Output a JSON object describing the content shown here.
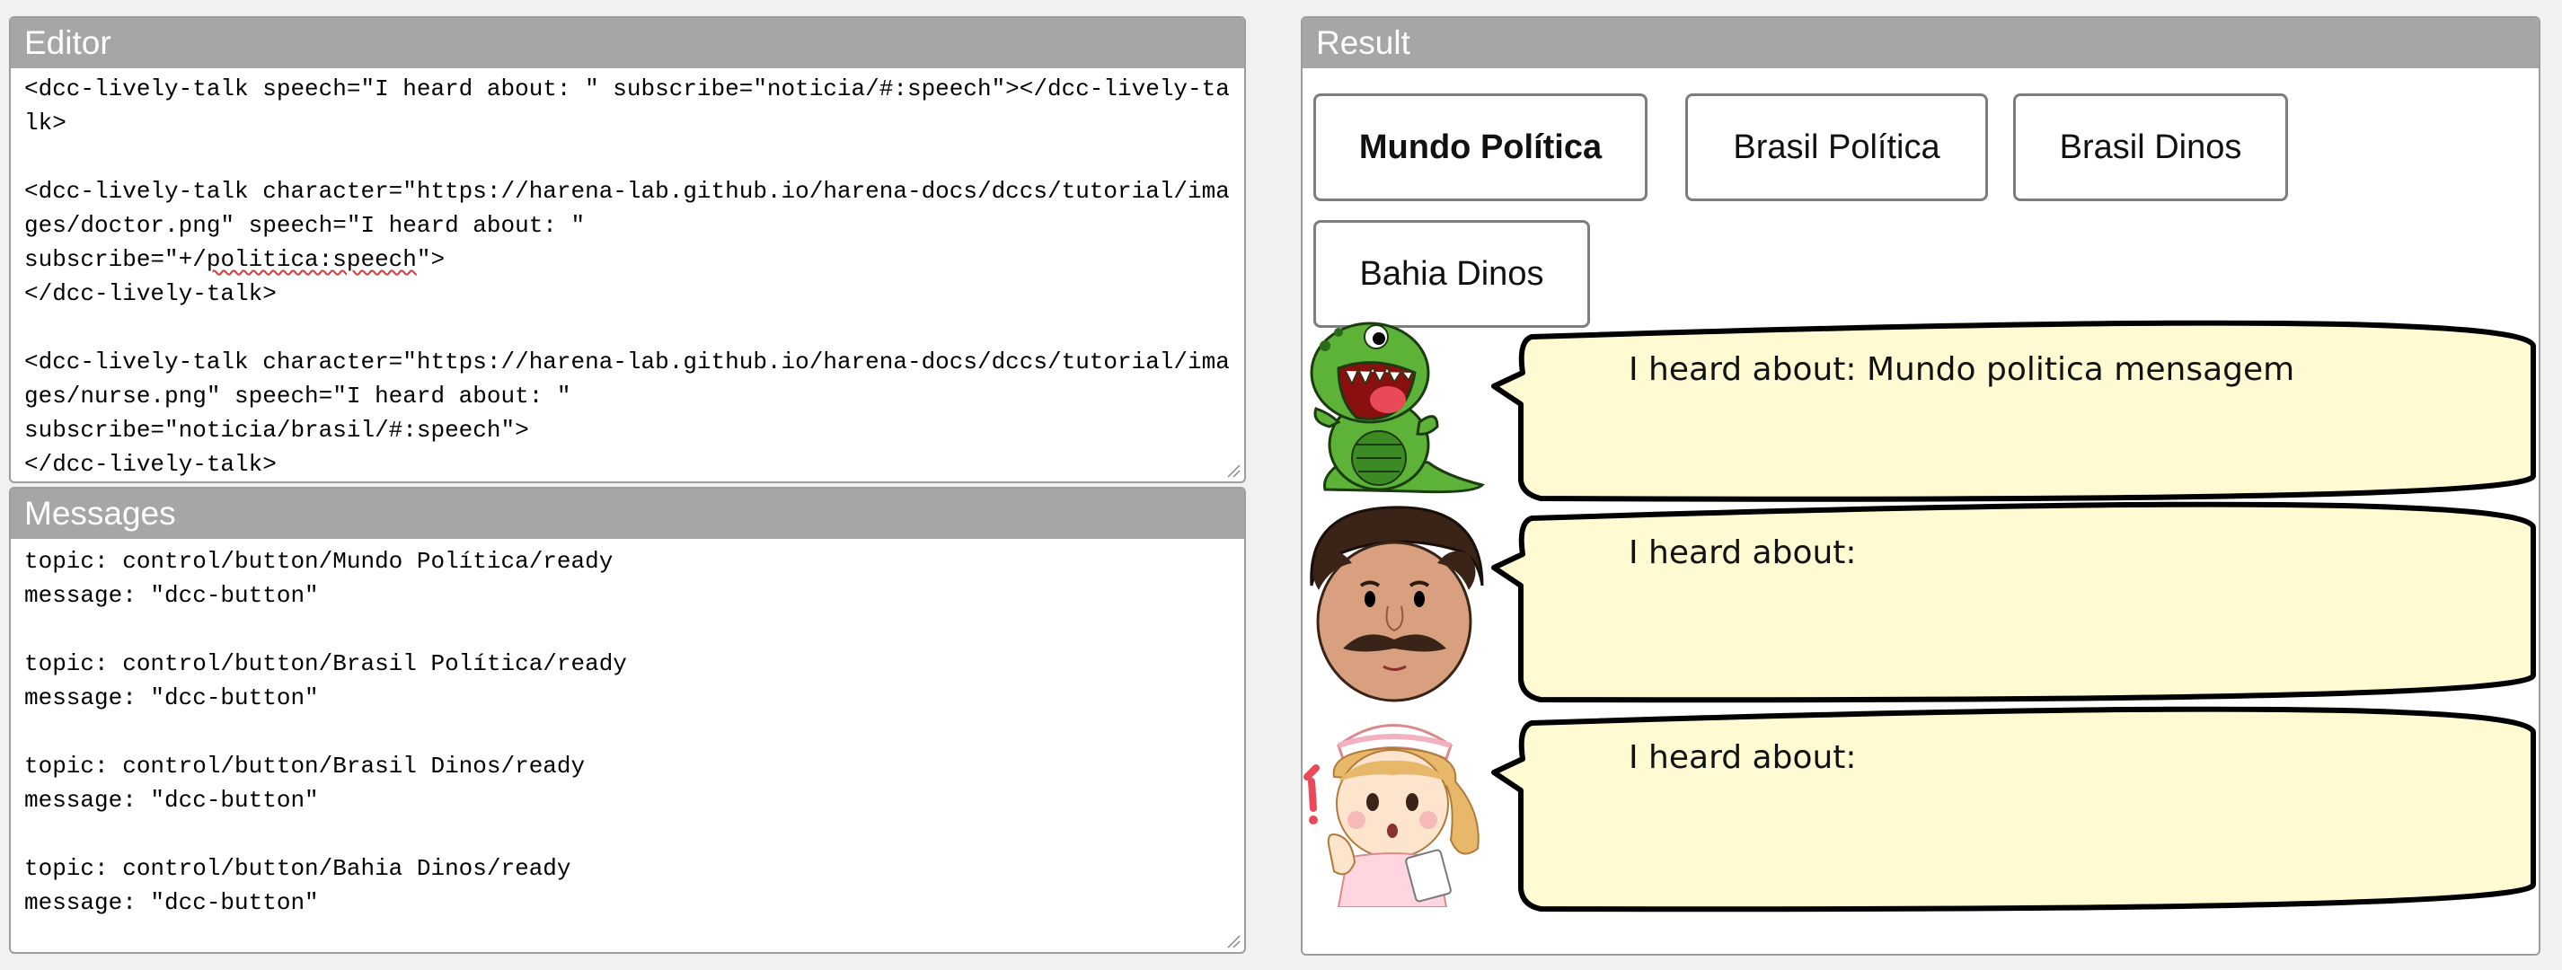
{
  "editor": {
    "title": "Editor",
    "code_before_spell": "<dcc-lively-talk speech=\"I heard about: \" subscribe=\"noticia/#:speech\"></dcc-lively-talk>\n\n<dcc-lively-talk character=\"https://harena-lab.github.io/harena-docs/dccs/tutorial/images/doctor.png\" speech=\"I heard about: \"\nsubscribe=\"+/",
    "code_spell": "politica:speech",
    "code_after_spell": "\">\n</dcc-lively-talk>\n\n<dcc-lively-talk character=\"https://harena-lab.github.io/harena-docs/dccs/tutorial/images/nurse.png\" speech=\"I heard about: \"\nsubscribe=\"noticia/brasil/#:speech\">\n</dcc-lively-talk>"
  },
  "messages": {
    "title": "Messages",
    "log": "topic: control/button/Mundo Política/ready\nmessage: \"dcc-button\"\n\ntopic: control/button/Brasil Política/ready\nmessage: \"dcc-button\"\n\ntopic: control/button/Brasil Dinos/ready\nmessage: \"dcc-button\"\n\ntopic: control/button/Bahia Dinos/ready\nmessage: \"dcc-button\""
  },
  "result": {
    "title": "Result",
    "buttons": [
      {
        "label": "Mundo Política"
      },
      {
        "label": "Brasil Política"
      },
      {
        "label": "Brasil Dinos"
      },
      {
        "label": "Bahia Dinos"
      }
    ],
    "talks": [
      {
        "character": "dino-icon",
        "speech": "I heard about: Mundo politica mensagem"
      },
      {
        "character": "doctor-icon",
        "speech": "I heard about:"
      },
      {
        "character": "nurse-icon",
        "speech": "I heard about:"
      }
    ]
  },
  "colors": {
    "header": "#a6a6a6",
    "bubble_fill": "#fffad2",
    "dino_green": "#5cb338"
  }
}
